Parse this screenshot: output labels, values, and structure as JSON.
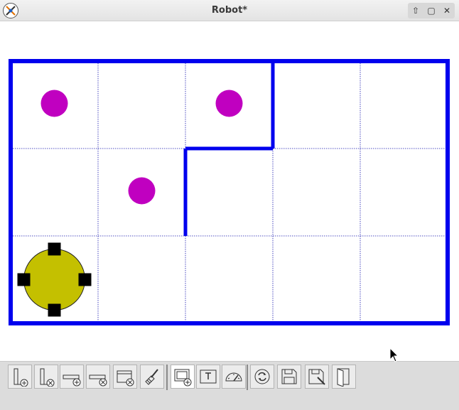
{
  "window": {
    "title": "Robot*"
  },
  "title_buttons": [
    {
      "name": "minimize-up-icon",
      "glyph": "⇧"
    },
    {
      "name": "maximize-icon",
      "glyph": "□"
    },
    {
      "name": "close-icon",
      "glyph": "✕"
    }
  ],
  "grid": {
    "cols": 5,
    "rows": 3
  },
  "colors": {
    "wall": "#0000ee",
    "grid_line": "#1a1ab0",
    "ball": "#c000c0",
    "robot": "#c4c000",
    "wheel": "#000000"
  },
  "balls": [
    {
      "col": 0,
      "row": 0
    },
    {
      "col": 2,
      "row": 0
    },
    {
      "col": 1,
      "row": 1
    }
  ],
  "robot": {
    "col": 0,
    "row": 2
  },
  "toolbar": {
    "buttons": [
      {
        "name": "add-vertical-wall-icon"
      },
      {
        "name": "remove-vertical-wall-icon"
      },
      {
        "name": "add-horizontal-wall-icon"
      },
      {
        "name": "remove-horizontal-wall-icon"
      },
      {
        "name": "remove-all-walls-icon"
      },
      {
        "name": "clear-brush-icon"
      },
      {
        "name": "add-ball-icon"
      },
      {
        "name": "text-ball-icon"
      },
      {
        "name": "speed-gauge-icon"
      },
      {
        "name": "reload-icon"
      },
      {
        "name": "save-icon"
      },
      {
        "name": "save-as-icon"
      },
      {
        "name": "open-door-icon"
      }
    ]
  }
}
